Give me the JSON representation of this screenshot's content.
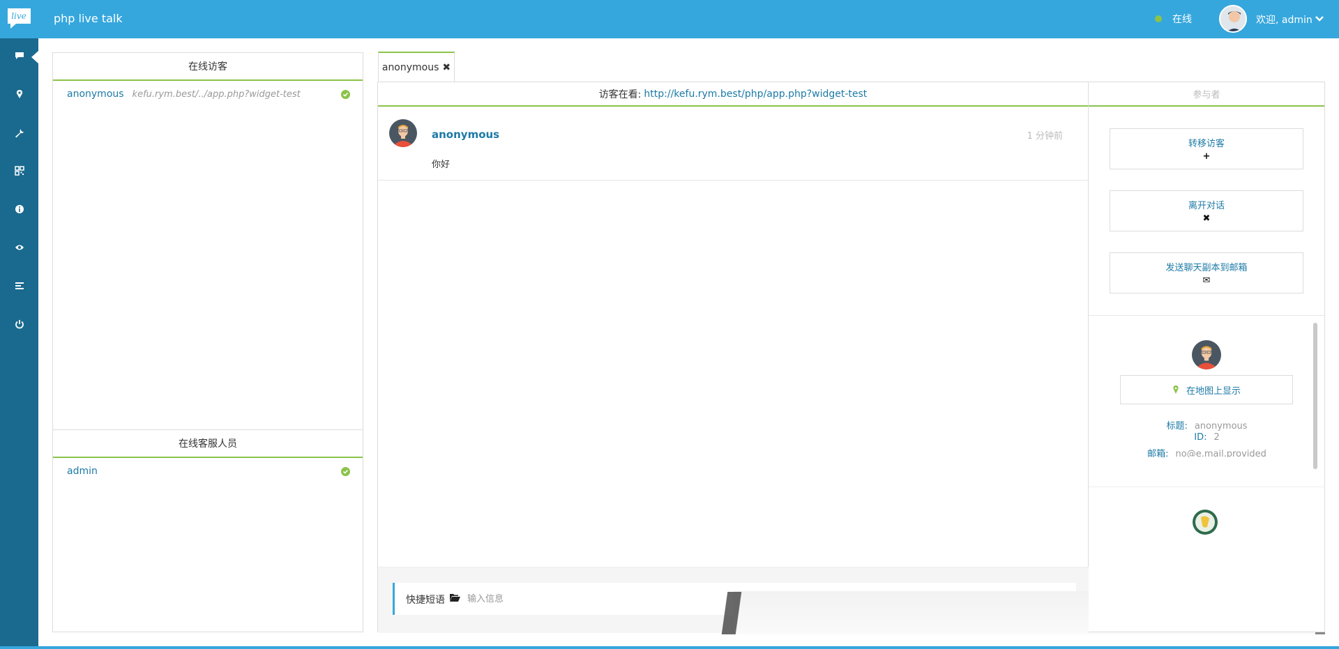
{
  "topbar": {
    "logo_text": "live",
    "app_title": "php live talk",
    "status": "在线",
    "welcome": "欢迎, admin"
  },
  "colors": {
    "primary": "#35a7dd",
    "rail": "#1a6a8f",
    "accent_green": "#8bc34a",
    "link": "#1c7aa6"
  },
  "rail": {
    "items": [
      {
        "icon": "chat-icon"
      },
      {
        "icon": "map-marker-icon"
      },
      {
        "icon": "wrench-icon"
      },
      {
        "icon": "qrcode-icon"
      },
      {
        "icon": "info-icon"
      },
      {
        "icon": "eye-icon"
      },
      {
        "icon": "align-left-icon"
      },
      {
        "icon": "power-icon"
      }
    ]
  },
  "visitors_panel": {
    "title": "在线访客",
    "items": [
      {
        "name": "anonymous",
        "url": "kefu.rym.best/../app.php?widget-test"
      }
    ]
  },
  "staff_panel": {
    "title": "在线客服人员",
    "items": [
      {
        "name": "admin"
      }
    ]
  },
  "chat": {
    "tab_label": "anonymous",
    "viewing_label": "访客在看:",
    "viewing_url": "http://kefu.rym.best/php/app.php?widget-test",
    "messages": [
      {
        "author": "anonymous",
        "time": "1 分钟前",
        "text": "你好"
      }
    ],
    "quick_phrases_label": "快捷短语",
    "input_placeholder": "输入信息"
  },
  "sidebar": {
    "title": "参与者",
    "buttons": [
      {
        "label": "转移访客",
        "icon": "+"
      },
      {
        "label": "离开对话",
        "icon": "✖"
      },
      {
        "label": "发送聊天副本到邮箱",
        "icon": "✉"
      }
    ],
    "map_button": "在地图上显示",
    "visitor_info": {
      "title_key": "标题:",
      "title_value": "anonymous",
      "id_key": "ID:",
      "id_value": "2",
      "email_key": "邮箱:",
      "email_value": "no@e.mail.provided"
    }
  }
}
